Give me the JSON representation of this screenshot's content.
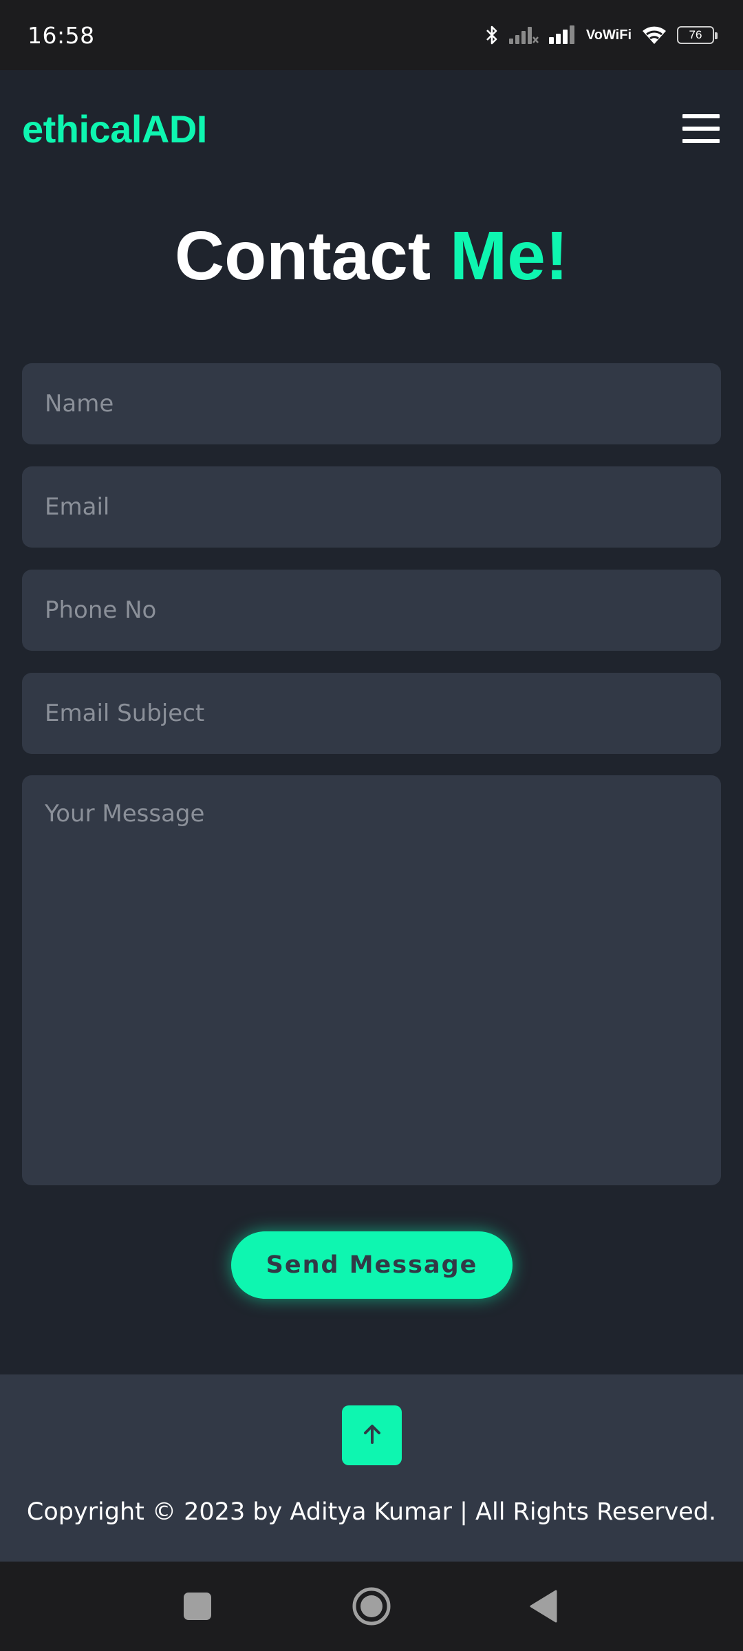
{
  "status_bar": {
    "time": "16:58",
    "vowifi_top": "Vo",
    "vowifi_bottom": "WiFi",
    "battery": "76",
    "icons": [
      "bluetooth-icon",
      "signal-sim2-icon",
      "signal-sim1-icon",
      "vowifi-icon",
      "wifi-icon",
      "battery-icon"
    ]
  },
  "header": {
    "logo": "ethicalADI",
    "menu_icon": "hamburger-menu-icon"
  },
  "title": {
    "main": "Contact",
    "accent": "Me!"
  },
  "form": {
    "name_placeholder": "Name",
    "email_placeholder": "Email",
    "phone_placeholder": "Phone No",
    "subject_placeholder": "Email Subject",
    "message_placeholder": "Your Message",
    "send_label": "Send Message"
  },
  "footer": {
    "top_icon": "arrow-up-icon",
    "copyright": "Copyright © 2023 by Aditya Kumar | All Rights Reserved."
  },
  "nav_bar": {
    "icons": [
      "recents-square-icon",
      "home-circle-icon",
      "back-triangle-icon"
    ]
  },
  "colors": {
    "background": "#1f242d",
    "surface": "#323946",
    "accent": "#0ef6b0",
    "text": "#ffffff",
    "placeholder": "#8b9099"
  }
}
